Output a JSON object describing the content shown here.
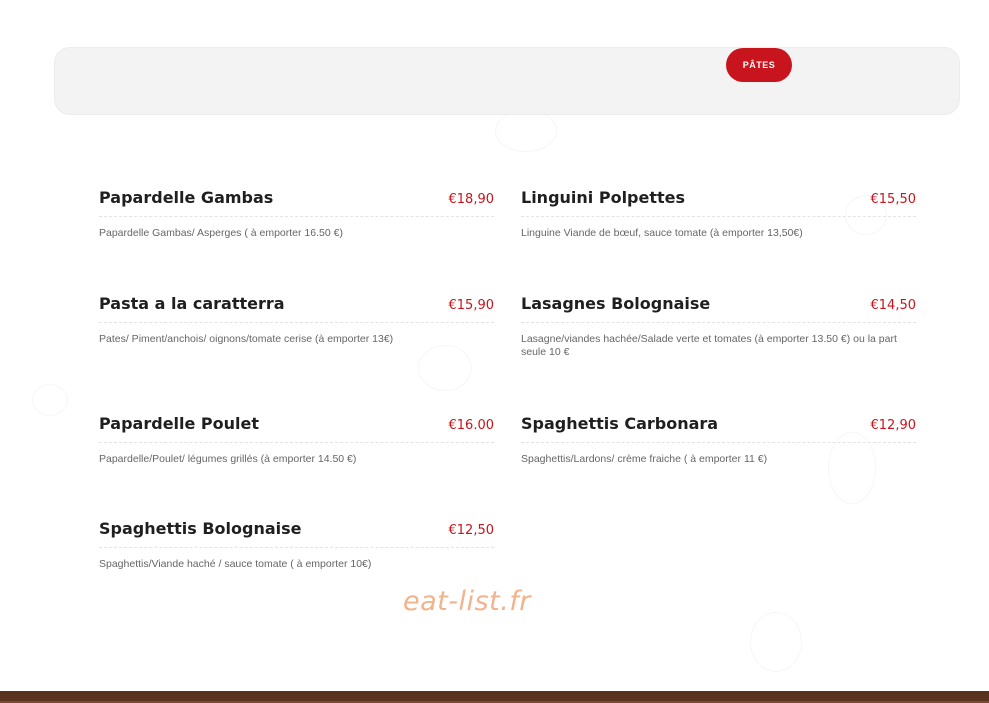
{
  "tabs": [
    {
      "label": "PÂTES",
      "active": true
    }
  ],
  "menu": [
    {
      "name": "Papardelle Gambas",
      "price": "€18,90",
      "description": "Papardelle Gambas/ Asperges ( à emporter 16.50 €)"
    },
    {
      "name": "Linguini Polpettes",
      "price": "€15,50",
      "description": "Linguine Viande de bœuf, sauce tomate (à emporter 13,50€)"
    },
    {
      "name": "Pasta a la caratterra",
      "price": "€15,90",
      "description": "Pates/ Piment/anchois/ oignons/tomate cerise (à emporter 13€)"
    },
    {
      "name": "Lasagnes Bolognaise",
      "price": "€14,50",
      "description": "Lasagne/viandes hachée/Salade verte et tomates (à emporter 13.50 €)  ou la part seule 10 €"
    },
    {
      "name": "Papardelle Poulet",
      "price": "€16.00",
      "description": "Papardelle/Poulet/ légumes grillés (à emporter 14.50 €)"
    },
    {
      "name": "Spaghettis Carbonara",
      "price": "€12,90",
      "description": "Spaghettis/Lardons/ crème fraiche ( à emporter 11 €)"
    },
    {
      "name": "Spaghettis Bolognaise",
      "price": "€12,50",
      "description": "Spaghettis/Viande haché / sauce tomate ( à emporter 10€)"
    }
  ],
  "watermark": "eat-list.fr",
  "colors": {
    "accent": "#c8141c",
    "border": "#5a3421",
    "watermark": "#f2b38c"
  }
}
